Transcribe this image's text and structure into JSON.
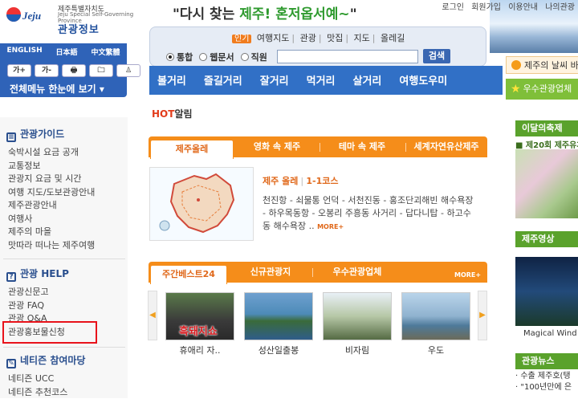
{
  "header": {
    "logo_text": "Jeju",
    "province_ko": "제주특별자치도",
    "province_en": "Jeju Special Self-Governing Province",
    "site_name": "관광정보",
    "slogan_quote_open": "\"",
    "slogan_pre": "다시 찾는 ",
    "slogan_jeju": "제주!",
    "slogan_post": " 혼저옵서예~",
    "slogan_quote_close": "\"",
    "top_links": [
      "로그인",
      "회원가입",
      "이용안내",
      "나의관광"
    ]
  },
  "lang": {
    "items": [
      "ENGLISH",
      "日本語",
      "中文繁體"
    ],
    "tools": [
      "가+",
      "가-",
      "🖶",
      "🗀",
      "♙"
    ],
    "all_menu": "전체메뉴 한눈에 보기 ▾"
  },
  "search": {
    "popular_tag": "인기",
    "popular_items": [
      "여행지도",
      "관광",
      "맛집",
      "지도",
      "올레길"
    ],
    "radio_options": [
      "통합",
      "웹문서",
      "직원"
    ],
    "selected_radio": "통합",
    "input_value": "",
    "button_label": "검색"
  },
  "nav": {
    "items": [
      "볼거리",
      "즐길거리",
      "잘거리",
      "먹거리",
      "살거리",
      "여행도우미"
    ]
  },
  "right": {
    "weather_text": "제주의 날씨 바",
    "shop_text": "우수관광업체",
    "festival_title": "이달의축제",
    "festival_sub": "■ 제20회 제주유채꽃",
    "video_title": "제주영상",
    "video_caption": "Magical Wind",
    "news_title": "관광뉴스",
    "news_items": [
      "· 수출 제주호(탱",
      "· \"100년만에 은"
    ]
  },
  "sidebar": {
    "guide_title": "관광가이드",
    "guide_items": [
      "숙박시설 요금 공개",
      "교통정보",
      "관광지 요금 및 시간",
      "여행 지도/도보관광안내",
      "제주관광안내",
      "여행사",
      "제주의 마을",
      "맛따라 떠나는 제주여행"
    ],
    "help_title_pre": "관광 ",
    "help_title_em": "HELP",
    "help_items": [
      "관광신문고",
      "관광 FAQ",
      "관광 Q&A",
      "관광홍보물신청"
    ],
    "netizen_title_pre": "네티즌 ",
    "netizen_title_em": "참여마당",
    "netizen_items": [
      "네티즌 UCC",
      "네티즌 추천코스"
    ]
  },
  "main": {
    "hot_title": "HOT",
    "hot_suffix": "알림",
    "tabs1": [
      "제주올레",
      "영화 속 제주",
      "테마 속 제주",
      "세계자연유산제주"
    ],
    "course_title_a": "제주 올레",
    "course_title_b": "1-1코스",
    "course_desc": "천진항 - 쇠물통 언덕 - 서천진동 - 홍조단괴해빈 해수욕장 - 하우목동항 - 오봉리 주흥동 사거리 - 답다니탑 - 하고수동 해수욕장 ..",
    "more_label": "MORE+",
    "tabs2": [
      "주간베스트24",
      "신규관광지",
      "우수관광업체"
    ],
    "more2_label": "MORE+",
    "thumbs": [
      {
        "caption": "휴애리 자..",
        "overlay": "흑돼지쇼"
      },
      {
        "caption": "성산일출봉",
        "overlay": ""
      },
      {
        "caption": "비자림",
        "overlay": ""
      },
      {
        "caption": "우도",
        "overlay": ""
      }
    ]
  },
  "colors": {
    "primary_blue": "#3170c6",
    "orange": "#f58d1a",
    "green": "#5aa22c",
    "highlight_red": "#e8131b"
  }
}
